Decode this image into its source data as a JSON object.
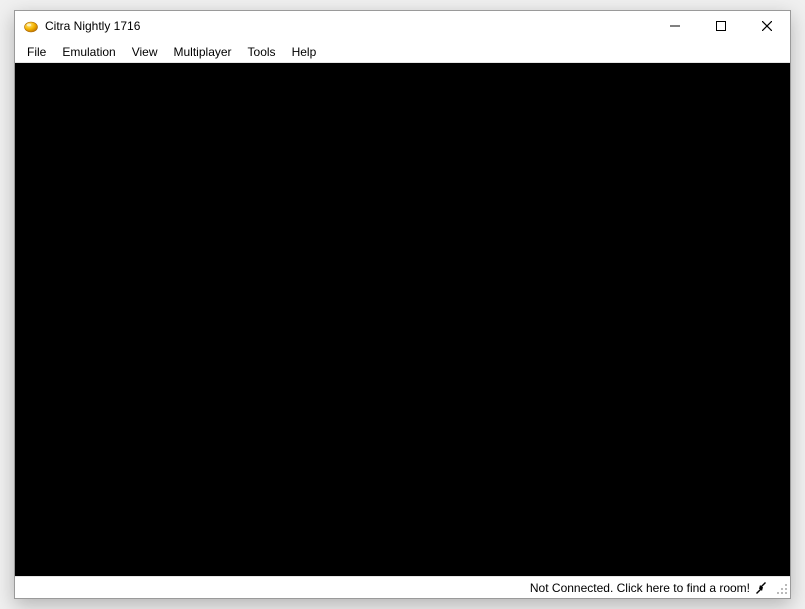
{
  "window": {
    "title": "Citra Nightly 1716"
  },
  "menubar": {
    "items": [
      "File",
      "Emulation",
      "View",
      "Multiplayer",
      "Tools",
      "Help"
    ]
  },
  "statusbar": {
    "connection_text": "Not Connected. Click here to find a room!"
  }
}
